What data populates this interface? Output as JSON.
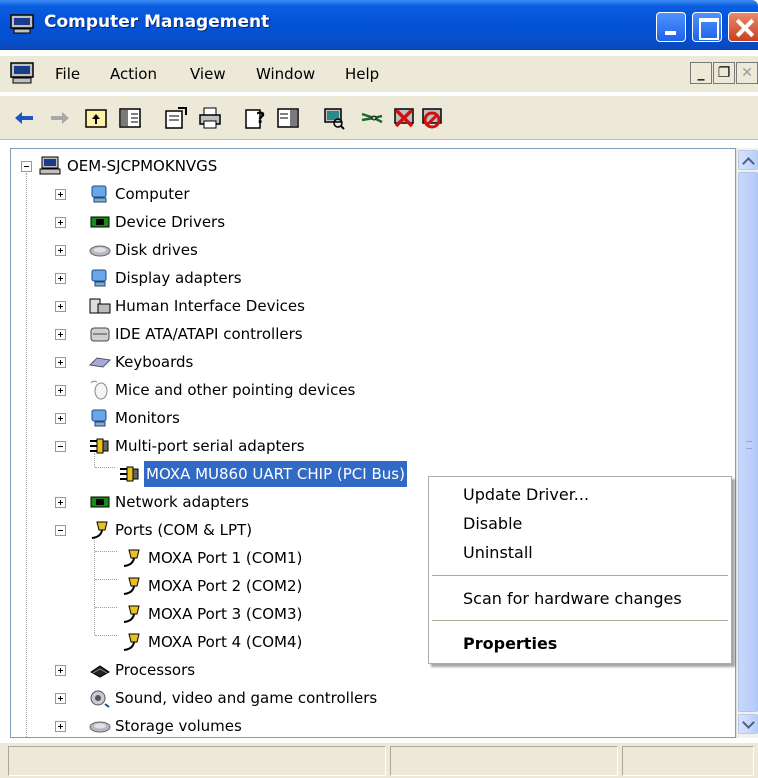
{
  "window": {
    "title": "Computer Management"
  },
  "menu": {
    "file": "File",
    "action": "Action",
    "view": "View",
    "window": "Window",
    "help": "Help"
  },
  "mdi_controls": {
    "minimize": "_",
    "restore": "❐",
    "close": "✕"
  },
  "toolbar": {
    "icons": [
      "back-arrow-icon",
      "forward-arrow-icon",
      "up-folder-icon",
      "show-hide-tree-icon",
      "properties-icon",
      "print-icon",
      "help-icon",
      "show-hide-action-pane-icon",
      "scan-hardware-icon",
      "update-driver-icon",
      "uninstall-icon",
      "disable-icon"
    ]
  },
  "tree": {
    "root": "OEM-SJCPMOKNVGS",
    "items": [
      {
        "label": "Computer",
        "icon": "computer-icon",
        "expander": "plus"
      },
      {
        "label": "Device Drivers",
        "icon": "chip-icon",
        "expander": "plus"
      },
      {
        "label": "Disk drives",
        "icon": "disk-icon",
        "expander": "plus"
      },
      {
        "label": "Display adapters",
        "icon": "display-icon",
        "expander": "plus"
      },
      {
        "label": "Human Interface Devices",
        "icon": "hid-icon",
        "expander": "plus"
      },
      {
        "label": "IDE ATA/ATAPI controllers",
        "icon": "ide-icon",
        "expander": "plus"
      },
      {
        "label": "Keyboards",
        "icon": "keyboard-icon",
        "expander": "plus"
      },
      {
        "label": "Mice and other pointing devices",
        "icon": "mouse-icon",
        "expander": "plus"
      },
      {
        "label": "Monitors",
        "icon": "monitor-icon",
        "expander": "plus"
      },
      {
        "label": "Multi-port serial adapters",
        "icon": "serial-adapter-icon",
        "expander": "minus"
      },
      {
        "label": "Network adapters",
        "icon": "network-icon",
        "expander": "plus"
      },
      {
        "label": "Ports (COM & LPT)",
        "icon": "port-icon",
        "expander": "minus"
      },
      {
        "label": "Processors",
        "icon": "processor-icon",
        "expander": "plus"
      },
      {
        "label": "Sound, video and game controllers",
        "icon": "sound-icon",
        "expander": "plus"
      },
      {
        "label": "Storage volumes",
        "icon": "storage-icon",
        "expander": "plus"
      }
    ],
    "serial_child": "MOXA MU860 UART CHIP (PCI Bus)",
    "ports": [
      "MOXA Port 1 (COM1)",
      "MOXA Port 2 (COM2)",
      "MOXA Port 3 (COM3)",
      "MOXA Port 4 (COM4)"
    ]
  },
  "context_menu": {
    "update_driver": "Update Driver...",
    "disable": "Disable",
    "uninstall": "Uninstall",
    "scan": "Scan for hardware changes",
    "properties": "Properties"
  },
  "colors": {
    "titlebar": "#0553d8",
    "selection": "#316ac5",
    "chrome": "#ece9d8"
  }
}
